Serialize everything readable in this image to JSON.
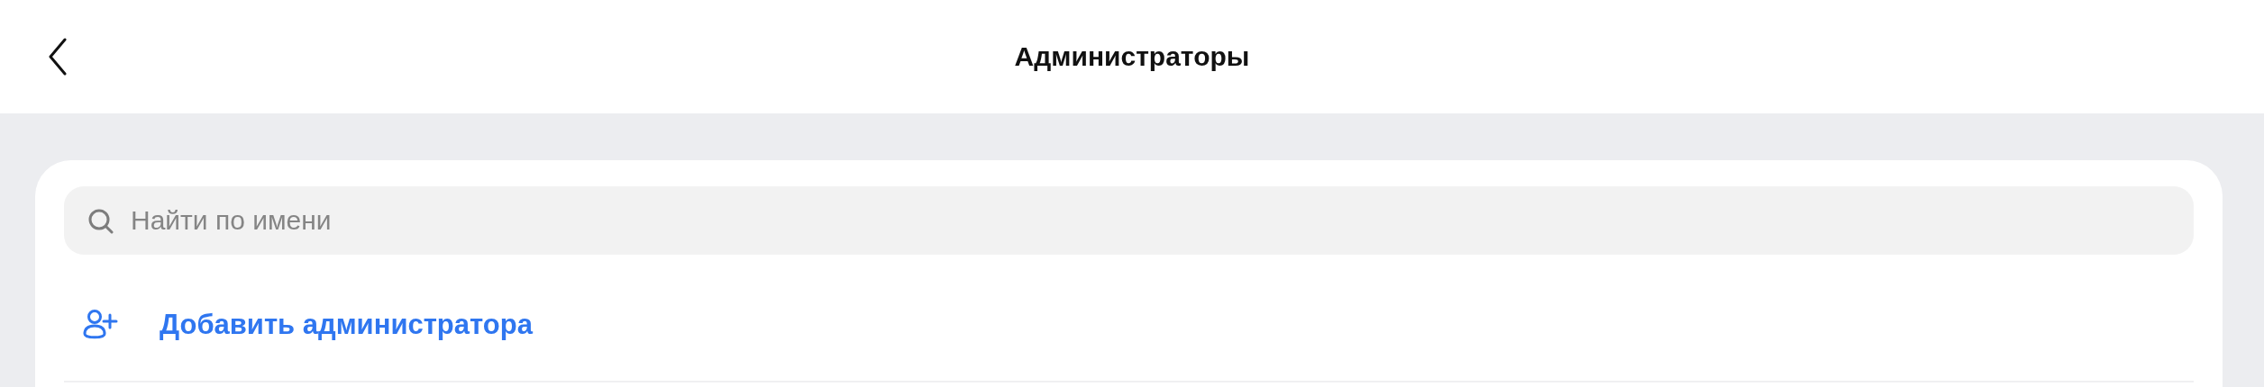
{
  "header": {
    "title": "Администраторы"
  },
  "search": {
    "placeholder": "Найти по имени"
  },
  "add_admin": {
    "label": "Добавить администратора"
  }
}
